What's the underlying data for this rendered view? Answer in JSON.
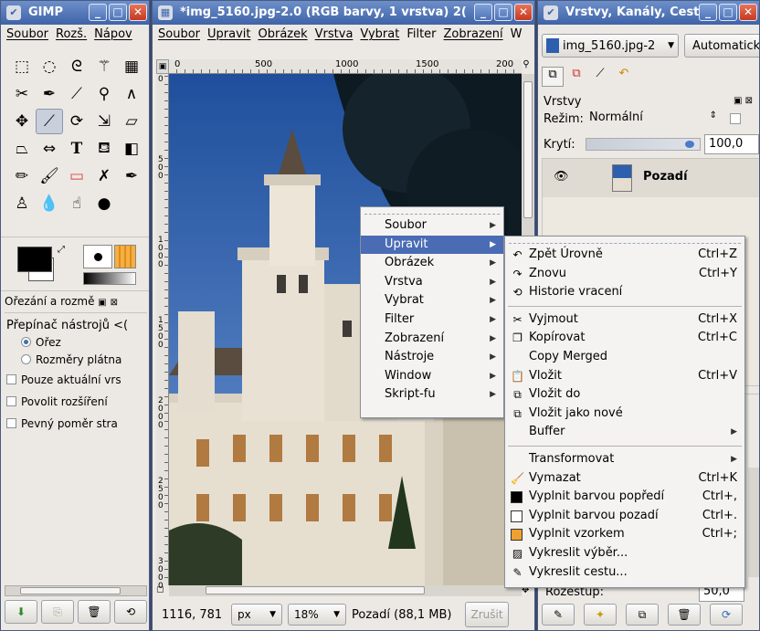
{
  "toolbox": {
    "title": "GIMP",
    "menu": [
      "Soubor",
      "Rozš.",
      "Nápov"
    ],
    "tool_options_title": "Ořezání a rozmě",
    "toggle_label": "Přepínač nástrojů  <(",
    "radio_crop": "Ořez",
    "radio_canvas": "Rozměry plátna",
    "check_current_layer": "Pouze aktuální vrs",
    "check_expand": "Povolit rozšíření",
    "check_fixed_ratio": "Pevný poměr stra"
  },
  "image_window": {
    "title": "*img_5160.jpg-2.0 (RGB barvy, 1 vrstva) 2(",
    "menu": [
      "Soubor",
      "Upravit",
      "Obrázek",
      "Vrstva",
      "Vybrat",
      "Filter",
      "Zobrazení",
      "W"
    ],
    "ruler_labels": [
      "0",
      "500",
      "1000",
      "1500",
      "200"
    ],
    "vruler_labels": [
      "0",
      "500",
      "1000",
      "1500",
      "2000",
      "2500",
      "3000"
    ],
    "coords": "1116, 781",
    "unit": "px",
    "zoom": "18%",
    "status": "Pozadí (88,1 MB)",
    "cancel": "Zrušit"
  },
  "layers_window": {
    "title": "Vrstvy, Kanály, Cest",
    "image_select": "img_5160.jpg-2",
    "auto_button": "Automaticky",
    "panel_title": "Vrstvy",
    "mode_label": "Režim:",
    "mode_value": "Normální",
    "opacity_label": "Krytí:",
    "opacity_value": "100,0",
    "layer_name": "Pozadí",
    "spacing_label": "Rozestup:",
    "spacing_value": "50,0"
  },
  "context_menu": [
    {
      "label": "Soubor",
      "u": "S"
    },
    {
      "label": "Upravit",
      "u": "U",
      "highlighted": true
    },
    {
      "label": "Obrázek",
      "u": "O"
    },
    {
      "label": "Vrstva",
      "u": "V"
    },
    {
      "label": "Vybrat",
      "u": "V"
    },
    {
      "label": "Filter"
    },
    {
      "label": "Zobrazení",
      "u": "Z"
    },
    {
      "label": "Nástroje",
      "u": "N"
    },
    {
      "label": "Window"
    },
    {
      "label": "Skript-fu"
    }
  ],
  "edit_menu": [
    {
      "label": "Zpět Úrovně",
      "shortcut": "Ctrl+Z",
      "icon": "undo-icon",
      "glyph": "↶"
    },
    {
      "label": "Znovu",
      "shortcut": "Ctrl+Y",
      "icon": "redo-icon",
      "glyph": "↷"
    },
    {
      "label": "Historie vracení",
      "icon": "undo-history-icon",
      "glyph": "⟲"
    },
    {
      "sep": true
    },
    {
      "label": "Vyjmout",
      "shortcut": "Ctrl+X",
      "icon": "cut-icon",
      "glyph": "✂"
    },
    {
      "label": "Kopírovat",
      "shortcut": "Ctrl+C",
      "icon": "copy-icon",
      "glyph": "❐"
    },
    {
      "label": "Copy Merged"
    },
    {
      "label": "Vložit",
      "shortcut": "Ctrl+V",
      "icon": "paste-icon",
      "glyph": "📋"
    },
    {
      "label": "Vložit do",
      "icon": "paste-into-icon",
      "glyph": "⧉"
    },
    {
      "label": "Vložit jako nové",
      "icon": "paste-as-new-icon",
      "glyph": "⧉"
    },
    {
      "label": "Buffer",
      "submenu": true
    },
    {
      "sep": true
    },
    {
      "label": "Transformovat",
      "submenu": true
    },
    {
      "label": "Vymazat",
      "shortcut": "Ctrl+K",
      "icon": "clear-icon",
      "glyph": "🧹"
    },
    {
      "label": "Vyplnit barvou popředí",
      "shortcut": "Ctrl+,",
      "icon": "fg-fill-icon",
      "swatch": "#000000"
    },
    {
      "label": "Vyplnit barvou pozadí",
      "shortcut": "Ctrl+.",
      "icon": "bg-fill-icon",
      "swatch": "#ffffff"
    },
    {
      "label": "Vyplnit vzorkem",
      "shortcut": "Ctrl+;",
      "icon": "pattern-fill-icon",
      "swatch": "#f0a030"
    },
    {
      "label": "Vykreslit výběr...",
      "icon": "stroke-selection-icon",
      "glyph": "▨"
    },
    {
      "label": "Vykreslit cestu...",
      "icon": "stroke-path-icon",
      "glyph": "✎"
    }
  ],
  "colors": {
    "accent": "#4a6cb5",
    "sky": "#2e5fae",
    "castle": "#e4ddd0",
    "roof": "#5a4c3e"
  }
}
